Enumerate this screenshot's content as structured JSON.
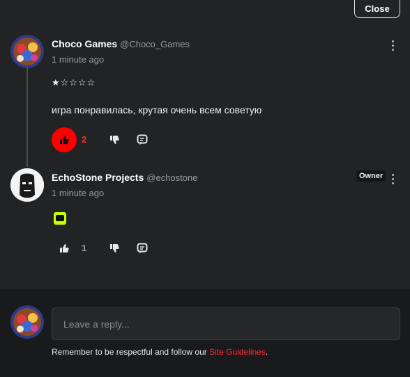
{
  "close_label": "Close",
  "comments": [
    {
      "author": "Choco Games",
      "handle": "@Choco_Games",
      "time": "1 minute ago",
      "rating": "★☆☆☆☆",
      "text": "игра понравилась, крутая очень всем советую",
      "likes": "2",
      "liked": true
    },
    {
      "author": "EchoStone Projects",
      "handle": "@echostone",
      "time": "1 minute ago",
      "badge": "Owner",
      "likes": "1",
      "liked": false
    }
  ],
  "reply": {
    "placeholder": "Leave a reply...",
    "notice": "Remember to be respectful and follow our",
    "link_label": "Site Guidelines",
    "notice_end": "."
  },
  "colors": {
    "background": "#212325",
    "accent": "#ff0000",
    "muted": "#9a9a9a"
  },
  "icons": [
    "thumbs-up-icon",
    "thumbs-down-icon",
    "comment-reply-icon",
    "more-vertical-icon"
  ]
}
